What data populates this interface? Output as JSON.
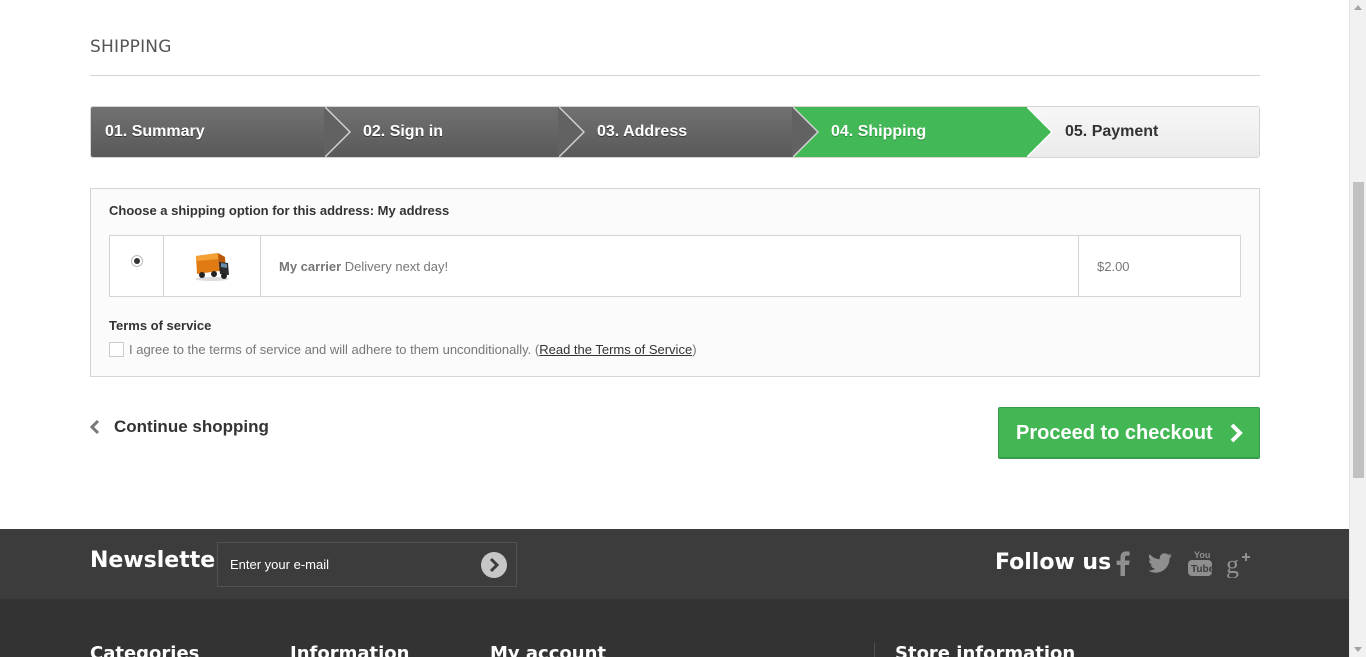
{
  "page": {
    "heading": "SHIPPING"
  },
  "steps": [
    {
      "label": "01. Summary",
      "state": "done"
    },
    {
      "label": "02. Sign in",
      "state": "done"
    },
    {
      "label": "03. Address",
      "state": "done"
    },
    {
      "label": "04. Shipping",
      "state": "current"
    },
    {
      "label": "05. Payment",
      "state": "todo"
    }
  ],
  "shipping": {
    "title": "Choose a shipping option for this address: My address",
    "carrier": {
      "selected": true,
      "icon": "delivery-truck-icon",
      "name": "My carrier",
      "description": "Delivery next day!",
      "price": "$2.00"
    },
    "tos": {
      "title": "Terms of service",
      "agree_text": "I agree to the terms of service and will adhere to them unconditionally.",
      "open_paren": "(",
      "link_text": "Read the Terms of Service",
      "close_paren": ")",
      "checked": false
    }
  },
  "actions": {
    "continue_label": "Continue shopping",
    "checkout_label": "Proceed to checkout"
  },
  "footer": {
    "newsletter_title": "Newsletter",
    "newsletter_placeholder": "Enter your e-mail",
    "follow_title": "Follow us",
    "social": [
      "facebook-icon",
      "twitter-icon",
      "youtube-icon",
      "google-plus-icon"
    ],
    "columns": [
      "Categories",
      "Information",
      "My account",
      "Store information"
    ]
  },
  "colors": {
    "accent_green": "#42b856",
    "step_dark": "#666666",
    "footer_dark": "#333333"
  }
}
